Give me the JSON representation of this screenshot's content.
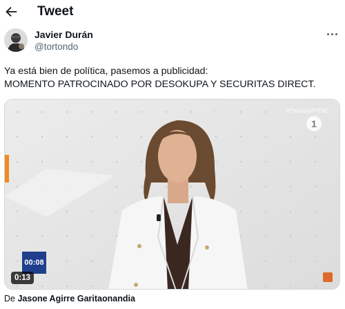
{
  "header": {
    "back_icon": "arrow-left-icon",
    "title": "Tweet"
  },
  "author": {
    "name": "Javier Durán",
    "handle": "@tortondo",
    "avatar_icon": "avatar-icon",
    "more_icon": "more-horizontal-icon"
  },
  "tweet": {
    "line1": "Ya está bien de política, pasemos a publicidad:",
    "line2": "MOMENTO PATROCINADO POR DESOKUPA Y SECURITAS DIRECT."
  },
  "media": {
    "watermark": "#Debatea7RTVE",
    "channel": "1",
    "clock": "00:08",
    "duration": "0:13",
    "broadcaster_icon": "rtve-logo-icon"
  },
  "attribution": {
    "prefix": "De",
    "author": "Jasone Agirre Garitaonandia"
  },
  "colors": {
    "text": "#0f1419",
    "secondary": "#536471",
    "clock_box": "#1f3f8c"
  }
}
